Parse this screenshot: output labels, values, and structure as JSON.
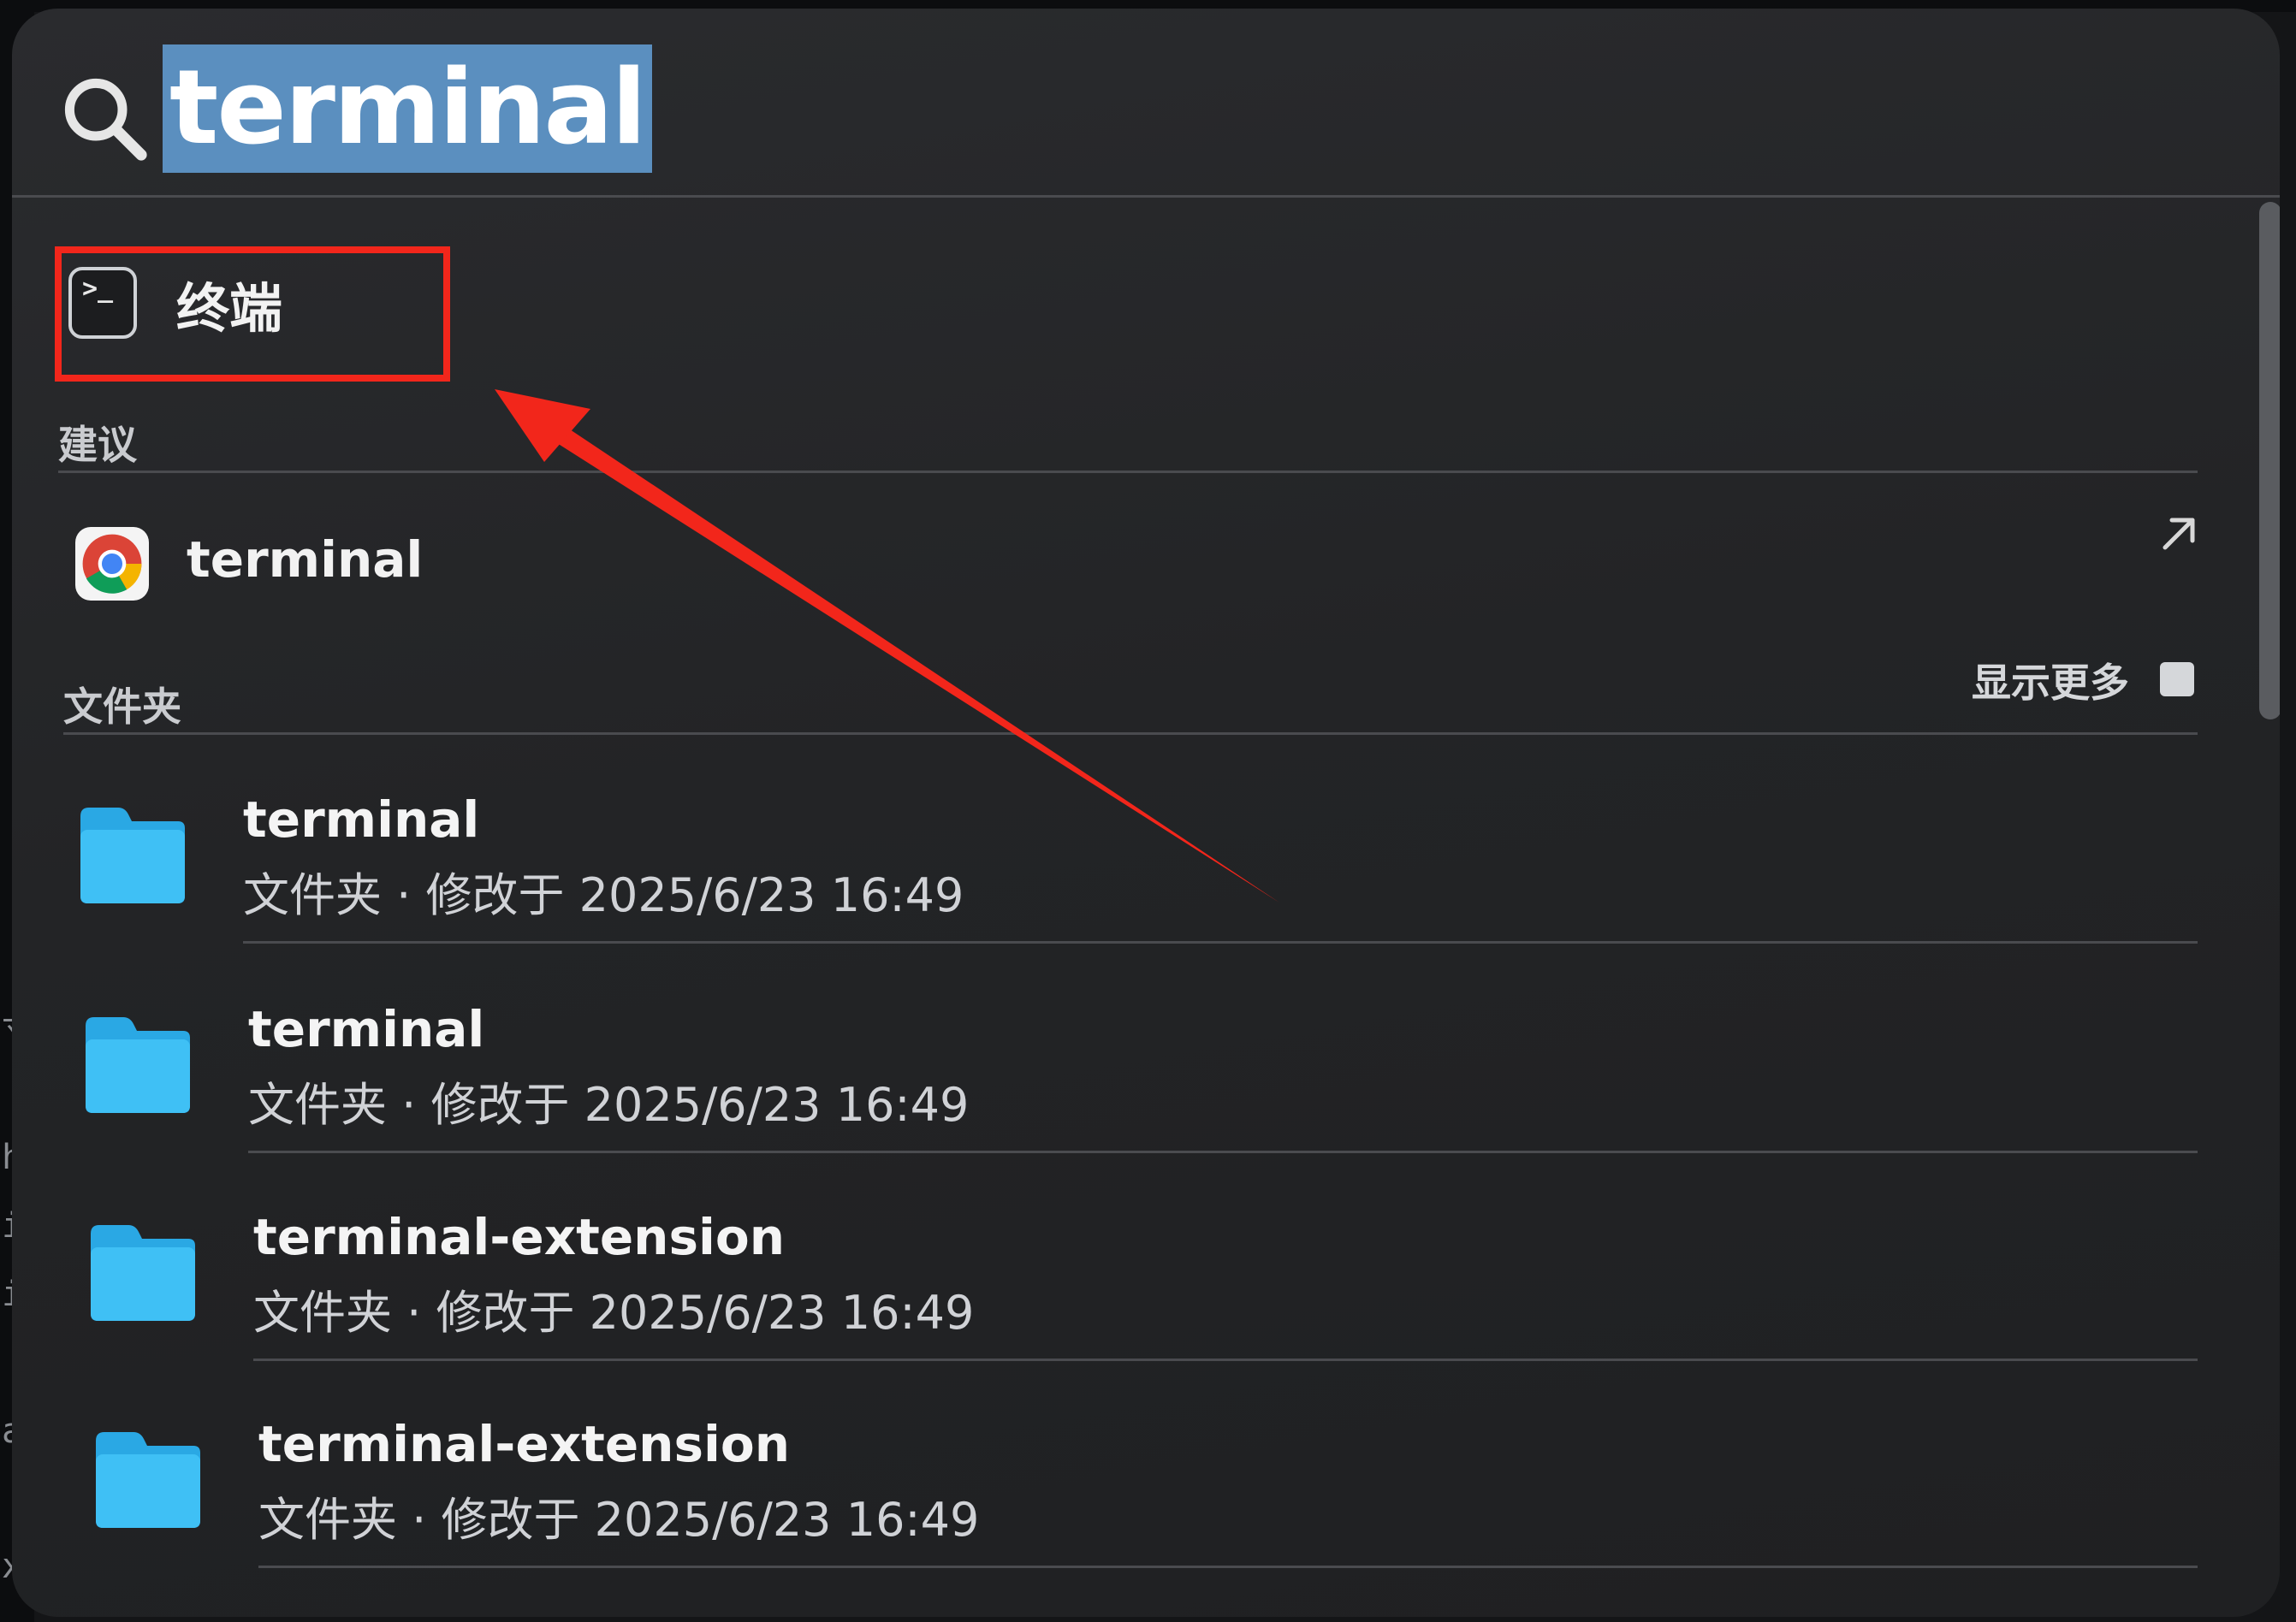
{
  "search": {
    "query": "terminal"
  },
  "top_hit": {
    "label": "终端",
    "icon": "terminal-app-icon",
    "prompt_glyph": ">_"
  },
  "suggestions": {
    "heading": "建议",
    "items": [
      {
        "label": "terminal",
        "icon": "chrome-icon",
        "action_icon": "open-arrow-icon"
      }
    ]
  },
  "folders": {
    "heading": "文件夹",
    "show_more_label": "显示更多",
    "items": [
      {
        "name": "terminal",
        "meta": "文件夹 · 修改于 2025/6/23 16:49"
      },
      {
        "name": "terminal",
        "meta": "文件夹 · 修改于 2025/6/23 16:49"
      },
      {
        "name": "terminal-extension",
        "meta": "文件夹 · 修改于 2025/6/23 16:49"
      },
      {
        "name": "terminal-extension",
        "meta": "文件夹 · 修改于 2025/6/23 16:49"
      }
    ]
  },
  "background_edge_text": [
    "寸",
    "h",
    "i",
    "i",
    "a",
    "xa"
  ],
  "colors": {
    "highlight_box": "#f2261b",
    "annotation_arrow": "#f2261b",
    "selection": "#5b8fbf",
    "folder": "#35b7ef"
  }
}
